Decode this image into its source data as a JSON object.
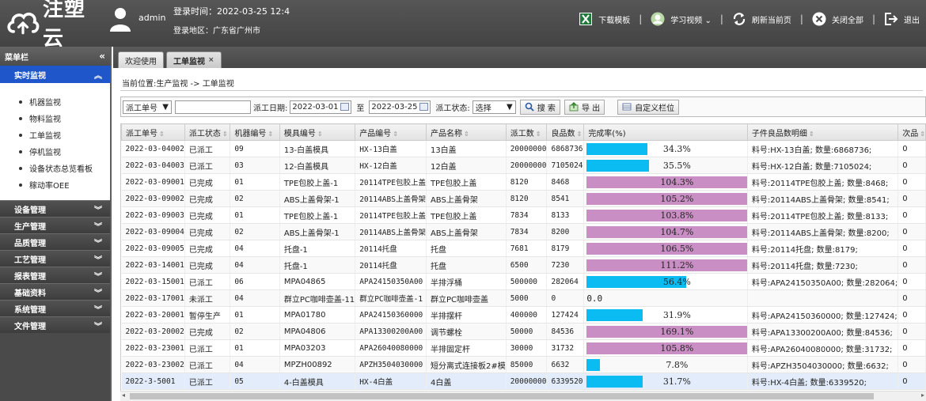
{
  "header": {
    "logo_text": "注塑云",
    "user": "admin",
    "login_time": "登录时间：2022-03-25 12:4",
    "login_area": "登录地区：广东省广州市",
    "actions": [
      {
        "label": "下载模板",
        "icon": "excel-icon"
      },
      {
        "label": "学习视频 ⌄",
        "icon": "video-avatar-icon"
      },
      {
        "label": "刷新当前页",
        "icon": "refresh-icon"
      },
      {
        "label": "关闭全部",
        "icon": "close-all-icon"
      },
      {
        "label": "退出",
        "icon": "logout-icon"
      }
    ]
  },
  "sidebar": {
    "title": "菜单栏",
    "active_group": "实时监视",
    "sub_items": [
      "机器监视",
      "物料监视",
      "工单监视",
      "停机监视",
      "设备状态总览看板",
      "稼动率OEE"
    ],
    "groups": [
      "设备管理",
      "生产管理",
      "品质管理",
      "工艺管理",
      "报表管理",
      "基础资料",
      "系统管理",
      "文件管理"
    ]
  },
  "tabs": [
    {
      "label": "欢迎使用",
      "active": false
    },
    {
      "label": "工单监视",
      "active": true,
      "close": "×"
    }
  ],
  "breadcrumb": "当前位置:生产监视 -> 工单监视",
  "toolbar": {
    "field_select": "派工单号",
    "date_label": "派工日期:",
    "date_from": "2022-03-01",
    "to_label": "至",
    "date_to": "2022-03-25",
    "status_label": "派工状态:",
    "status_select": "选择",
    "search_label": "搜 索",
    "export_label": "导 出",
    "custom_label": "自定义栏位"
  },
  "table": {
    "columns": [
      "派工单号",
      "派工状态",
      "机器编号",
      "模具编号",
      "产品编号",
      "产品名称",
      "派工数",
      "良品数",
      "完成率(%)",
      "子件良品数明细",
      "次品"
    ],
    "rows": [
      {
        "no": "2022-03-04002",
        "status": "已派工",
        "machine": "09",
        "mold": "13-白盖模具",
        "product": "HX-13白盖",
        "name": "13白盖",
        "qty": "20000000",
        "good": "6868736",
        "rate": 34.3,
        "rate_text": "34.3%",
        "detail": "料号:HX-13白盖; 数量:6868736;",
        "defect": "0"
      },
      {
        "no": "2022-03-04003",
        "status": "已派工",
        "machine": "03",
        "mold": "12-白盖模具",
        "product": "HX-12白盖",
        "name": "12白盖",
        "qty": "20000000",
        "good": "7105024",
        "rate": 35.5,
        "rate_text": "35.5%",
        "detail": "料号:HX-12白盖; 数量:7105024;",
        "defect": "0"
      },
      {
        "no": "2022-03-09001",
        "status": "已完成",
        "machine": "01",
        "mold": "TPE包胶上盖-1",
        "product": "20114TPE包胶上盖",
        "name": "TPE包胶上盖",
        "qty": "8120",
        "good": "8468",
        "rate": 104.3,
        "rate_text": "104.3%",
        "detail": "料号:20114TPE包胶上盖; 数量:8468;",
        "defect": "0"
      },
      {
        "no": "2022-03-09002",
        "status": "已完成",
        "machine": "02",
        "mold": "ABS上盖骨架-1",
        "product": "20114ABS上盖骨架",
        "name": "ABS上盖骨架",
        "qty": "8120",
        "good": "8541",
        "rate": 105.2,
        "rate_text": "105.2%",
        "detail": "料号:20114ABS上盖骨架; 数量:8541;",
        "defect": "0"
      },
      {
        "no": "2022-03-09003",
        "status": "已完成",
        "machine": "01",
        "mold": "TPE包胶上盖-1",
        "product": "20114TPE包胶上盖",
        "name": "TPE包胶上盖",
        "qty": "7834",
        "good": "8133",
        "rate": 103.8,
        "rate_text": "103.8%",
        "detail": "料号:20114TPE包胶上盖; 数量:8133;",
        "defect": "0"
      },
      {
        "no": "2022-03-09004",
        "status": "已完成",
        "machine": "02",
        "mold": "ABS上盖骨架-1",
        "product": "20114ABS上盖骨架",
        "name": "ABS上盖骨架",
        "qty": "7834",
        "good": "8200",
        "rate": 104.7,
        "rate_text": "104.7%",
        "detail": "料号:20114ABS上盖骨架; 数量:8200;",
        "defect": "0"
      },
      {
        "no": "2022-03-09005",
        "status": "已完成",
        "machine": "04",
        "mold": "托盘-1",
        "product": "20114托盘",
        "name": "托盘",
        "qty": "7681",
        "good": "8179",
        "rate": 106.5,
        "rate_text": "106.5%",
        "detail": "料号:20114托盘; 数量:8179;",
        "defect": "0"
      },
      {
        "no": "2022-03-14001",
        "status": "已完成",
        "machine": "04",
        "mold": "托盘-1",
        "product": "20114托盘",
        "name": "托盘",
        "qty": "6500",
        "good": "7230",
        "rate": 111.2,
        "rate_text": "111.2%",
        "detail": "料号:20114托盘; 数量:7230;",
        "defect": "0"
      },
      {
        "no": "2022-03-15001",
        "status": "已派工",
        "machine": "06",
        "mold": "MPA04865",
        "product": "APA24150350A00",
        "name": "半排浮桶",
        "qty": "500000",
        "good": "282064",
        "rate": 56.4,
        "rate_text": "56.4%",
        "detail": "料号:APA24150350A00; 数量:282064;",
        "defect": "0"
      },
      {
        "no": "2022-03-17001",
        "status": "未派工",
        "machine": "04",
        "mold": "群立PC咖啡壶盖-11",
        "product": "群立PC咖啡壶盖-1",
        "name": "群立PC咖啡壶盖",
        "qty": "5000",
        "good": "0",
        "rate": 0,
        "rate_text": "0.0",
        "detail": "",
        "defect": "0"
      },
      {
        "no": "2022-03-20001",
        "status": "暂停生产",
        "machine": "01",
        "mold": "MPA01780",
        "product": "APA24150360000",
        "name": "半排摆杆",
        "qty": "400000",
        "good": "127424",
        "rate": 31.9,
        "rate_text": "31.9%",
        "detail": "料号:APA24150360000; 数量:127424;",
        "defect": "0"
      },
      {
        "no": "2022-03-20002",
        "status": "已完成",
        "machine": "02",
        "mold": "MPA04806",
        "product": "APA13300200A00",
        "name": "调节螺栓",
        "qty": "50000",
        "good": "84536",
        "rate": 169.1,
        "rate_text": "169.1%",
        "detail": "料号:APA13300200A00; 数量:84536;",
        "defect": "0"
      },
      {
        "no": "2022-03-23001",
        "status": "已派工",
        "machine": "01",
        "mold": "MPA03203",
        "product": "APA26040080000",
        "name": "半排固定杆",
        "qty": "30000",
        "good": "31732",
        "rate": 105.8,
        "rate_text": "105.8%",
        "detail": "料号:APA26040080000; 数量:31732;",
        "defect": "0"
      },
      {
        "no": "2022-03-23002",
        "status": "已派工",
        "machine": "04",
        "mold": "MPZH00892",
        "product": "APZH3504030000",
        "name": "短分离式连接板2#模",
        "qty": "85000",
        "good": "6632",
        "rate": 7.8,
        "rate_text": "7.8%",
        "detail": "料号:APZH3504030000; 数量:6632;",
        "defect": "0"
      },
      {
        "no": "2022-3-5001",
        "status": "已派工",
        "machine": "05",
        "mold": "4-白盖模具",
        "product": "HX-4白盖",
        "name": "4白盖",
        "qty": "20000000",
        "good": "6339520",
        "rate": 31.7,
        "rate_text": "31.7%",
        "detail": "料号:HX-4白盖; 数量:6339520;",
        "defect": "0",
        "selected": true
      }
    ]
  },
  "colors": {
    "progress": "#0bbcf2",
    "over_complete": "#c98fc4",
    "accent": "#1f56c9"
  }
}
